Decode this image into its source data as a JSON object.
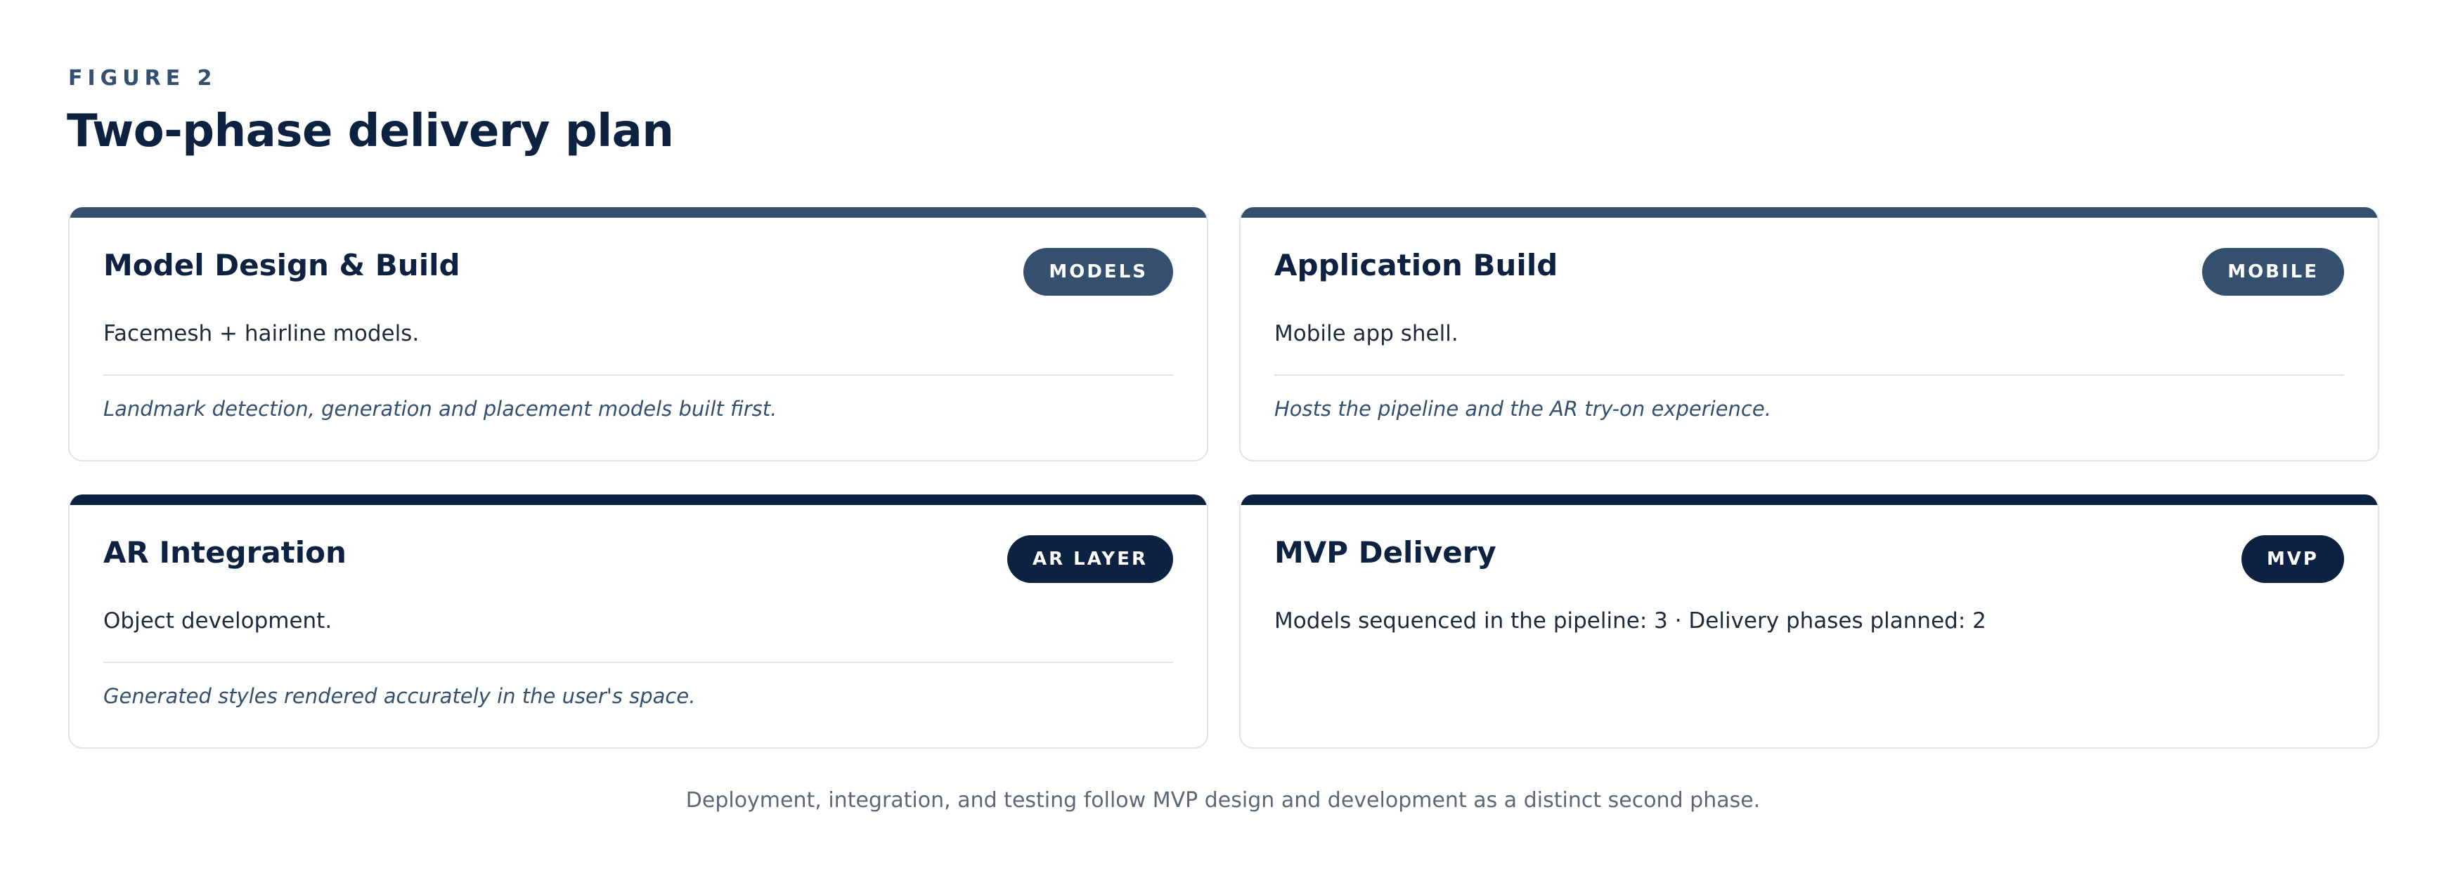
{
  "figure": {
    "label": "FIGURE 2",
    "title": "Two-phase delivery plan"
  },
  "cards": [
    {
      "title": "Model Design & Build",
      "badge": "MODELS",
      "description": "Facemesh + hairline models.",
      "note": "Landmark detection, generation and placement models built first."
    },
    {
      "title": "Application Build",
      "badge": "MOBILE",
      "description": "Mobile app shell.",
      "note": "Hosts the pipeline and the AR try-on experience."
    },
    {
      "title": "AR Integration",
      "badge": "AR LAYER",
      "description": "Object development.",
      "note": "Generated styles rendered accurately in the user's space."
    },
    {
      "title": "MVP Delivery",
      "badge": "MVP",
      "description": "Models sequenced in the pipeline: 3 · Delivery phases planned: 2"
    }
  ],
  "footnote": "Deployment, integration, and testing follow MVP design and development as a distinct second phase.",
  "colors": {
    "phase1_accent": "#34506e",
    "phase2_accent": "#0d2240",
    "border": "#dfe3e8"
  }
}
